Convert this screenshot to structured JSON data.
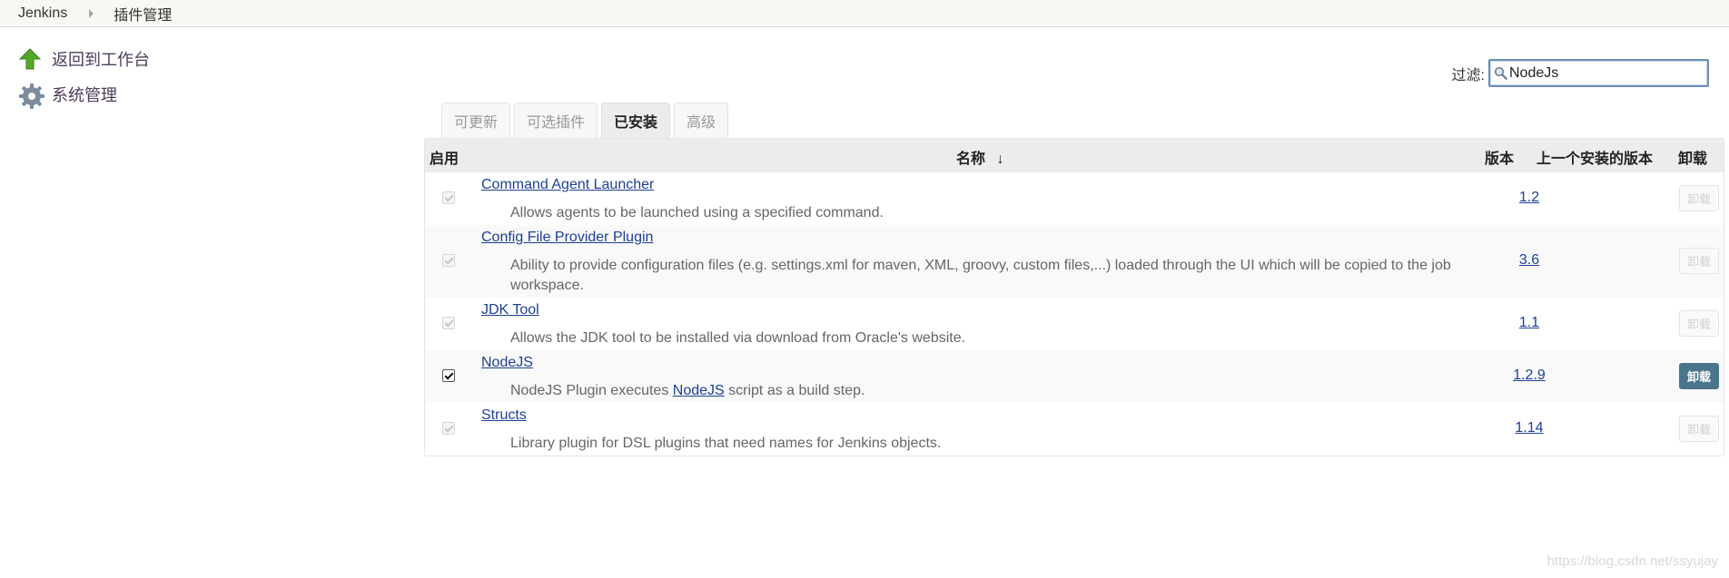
{
  "breadcrumb": [
    {
      "label": "Jenkins"
    },
    {
      "label": "插件管理"
    }
  ],
  "side_tasks": [
    {
      "label": "返回到工作台",
      "icon": "up-arrow-icon"
    },
    {
      "label": "系统管理",
      "icon": "gear-icon"
    }
  ],
  "filter": {
    "label": "过滤:",
    "value": "NodeJs",
    "icon": "search-icon"
  },
  "tabs": [
    {
      "label": "可更新",
      "active": false
    },
    {
      "label": "可选插件",
      "active": false
    },
    {
      "label": "已安装",
      "active": true
    },
    {
      "label": "高级",
      "active": false
    }
  ],
  "table": {
    "headers": {
      "enabled": "启用",
      "name": "名称",
      "sort_indicator": "↓",
      "version": "版本",
      "previous_version": "上一个安装的版本",
      "uninstall": "卸载"
    },
    "rows": [
      {
        "name": "Command Agent Launcher",
        "description": "Allows agents to be launched using a specified command.",
        "version": "1.2",
        "enabled": true,
        "checkbox_disabled": true,
        "uninstall_label": "卸载",
        "uninstall_enabled": false
      },
      {
        "name": "Config File Provider Plugin",
        "description": "Ability to provide configuration files (e.g. settings.xml for maven, XML, groovy, custom files,...) loaded through the UI which will be copied to the job workspace.",
        "version": "3.6",
        "enabled": true,
        "checkbox_disabled": true,
        "uninstall_label": "卸载",
        "uninstall_enabled": false
      },
      {
        "name": "JDK Tool",
        "description": "Allows the JDK tool to be installed via download from Oracle's website.",
        "version": "1.1",
        "enabled": true,
        "checkbox_disabled": true,
        "uninstall_label": "卸载",
        "uninstall_enabled": false
      },
      {
        "name": "NodeJS",
        "description_prefix": "NodeJS Plugin executes ",
        "description_link": "NodeJS",
        "description_suffix": " script as a build step.",
        "version": "1.2.9",
        "enabled": true,
        "checkbox_disabled": false,
        "uninstall_label": "卸载",
        "uninstall_enabled": true
      },
      {
        "name": "Structs",
        "description": "Library plugin for DSL plugins that need names for Jenkins objects.",
        "version": "1.14",
        "enabled": true,
        "checkbox_disabled": true,
        "uninstall_label": "卸载",
        "uninstall_enabled": false
      }
    ]
  },
  "watermark": "https://blog.csdn.net/ssyujay",
  "colors": {
    "link": "#1c3f94",
    "uninstall_button": "#4b758b",
    "header_background": "#ececec",
    "breadcrumb_background": "#f7f8f3"
  }
}
